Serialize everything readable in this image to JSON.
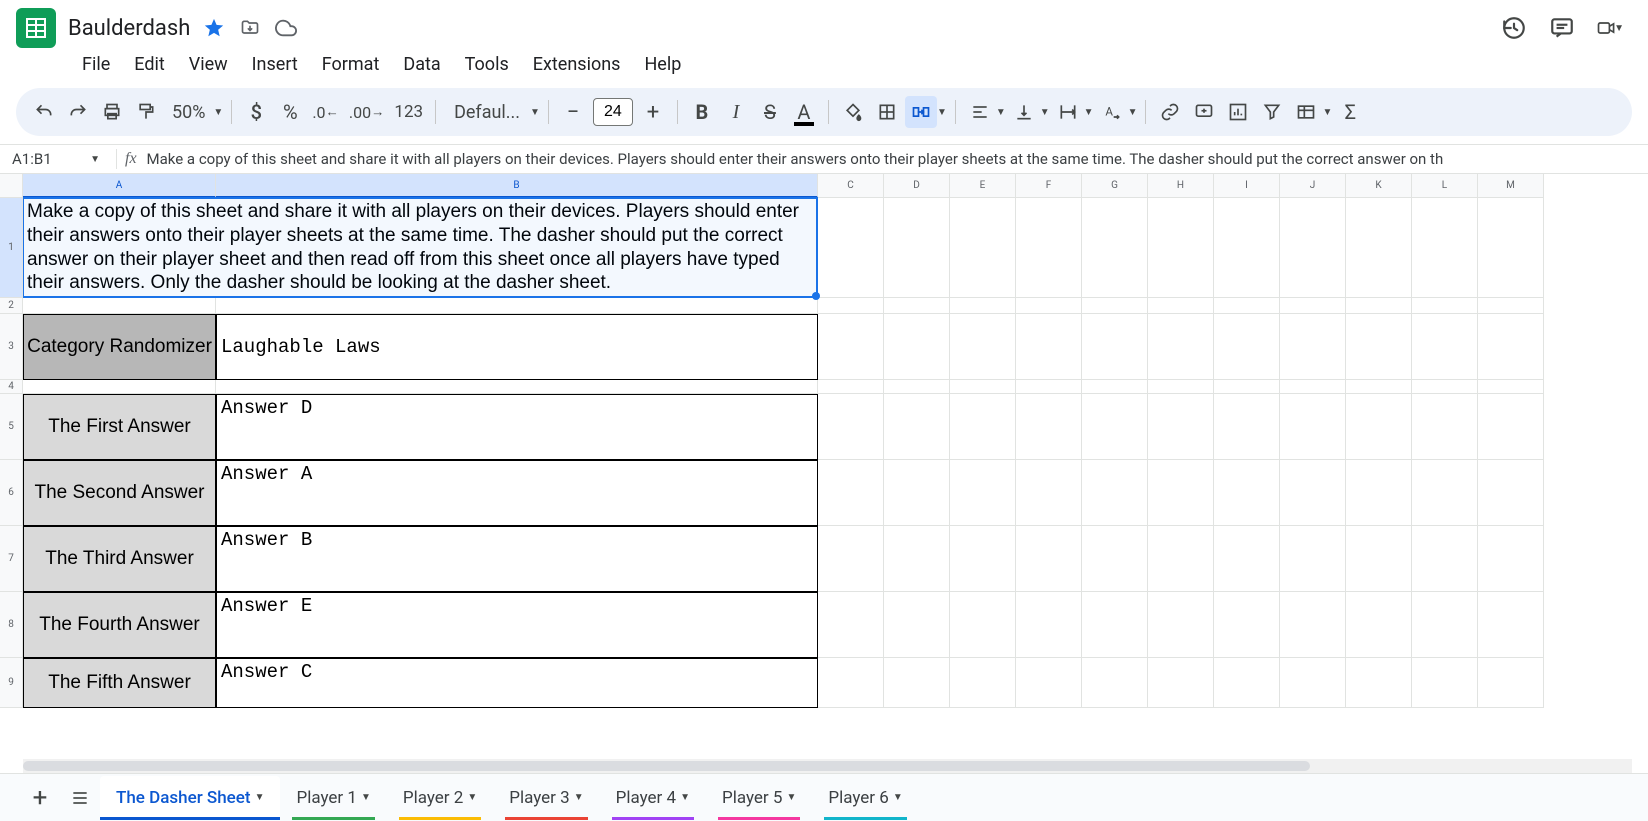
{
  "doc": {
    "title": "Baulderdash"
  },
  "menus": [
    "File",
    "Edit",
    "View",
    "Insert",
    "Format",
    "Data",
    "Tools",
    "Extensions",
    "Help"
  ],
  "toolbar": {
    "zoom": "50%",
    "font_name": "Defaul...",
    "font_size": "24",
    "numfmt_123": "123"
  },
  "formula": {
    "name_box": "A1:B1",
    "fx": "fx",
    "text": "Make a copy of this sheet and share it with all players on their devices. Players should enter their answers onto their player sheets at the same time. The dasher should put the correct answer on th"
  },
  "columns": [
    "A",
    "B",
    "C",
    "D",
    "E",
    "F",
    "G",
    "H",
    "I",
    "J",
    "K",
    "L",
    "M"
  ],
  "row_nums": [
    "1",
    "2",
    "3",
    "4",
    "5",
    "6",
    "7",
    "8",
    "9"
  ],
  "content": {
    "instructions": "Make a copy of this sheet and share it with all players on their devices. Players should enter their answers onto their player sheets at the same time. The dasher should put the correct answer on their player sheet and then read off from this sheet once all players have typed their answers. Only the dasher should be looking at the dasher sheet.",
    "category_label": "Category Randomizer",
    "category_value": "Laughable Laws",
    "rows": [
      {
        "label": "The First Answer",
        "value": "Answer D"
      },
      {
        "label": "The Second Answer",
        "value": "Answer A"
      },
      {
        "label": "The Third Answer",
        "value": "Answer B"
      },
      {
        "label": "The Fourth Answer",
        "value": "Answer E"
      },
      {
        "label": "The Fifth Answer",
        "value": "Answer C"
      }
    ]
  },
  "sheets": {
    "active": "The Dasher Sheet",
    "tabs": [
      "Player 1",
      "Player 2",
      "Player 3",
      "Player 4",
      "Player 5",
      "Player 6"
    ],
    "colors": [
      "#34a853",
      "#fbbc04",
      "#ea4335",
      "#a142f4",
      "#f538a0",
      "#12b5cb"
    ]
  }
}
